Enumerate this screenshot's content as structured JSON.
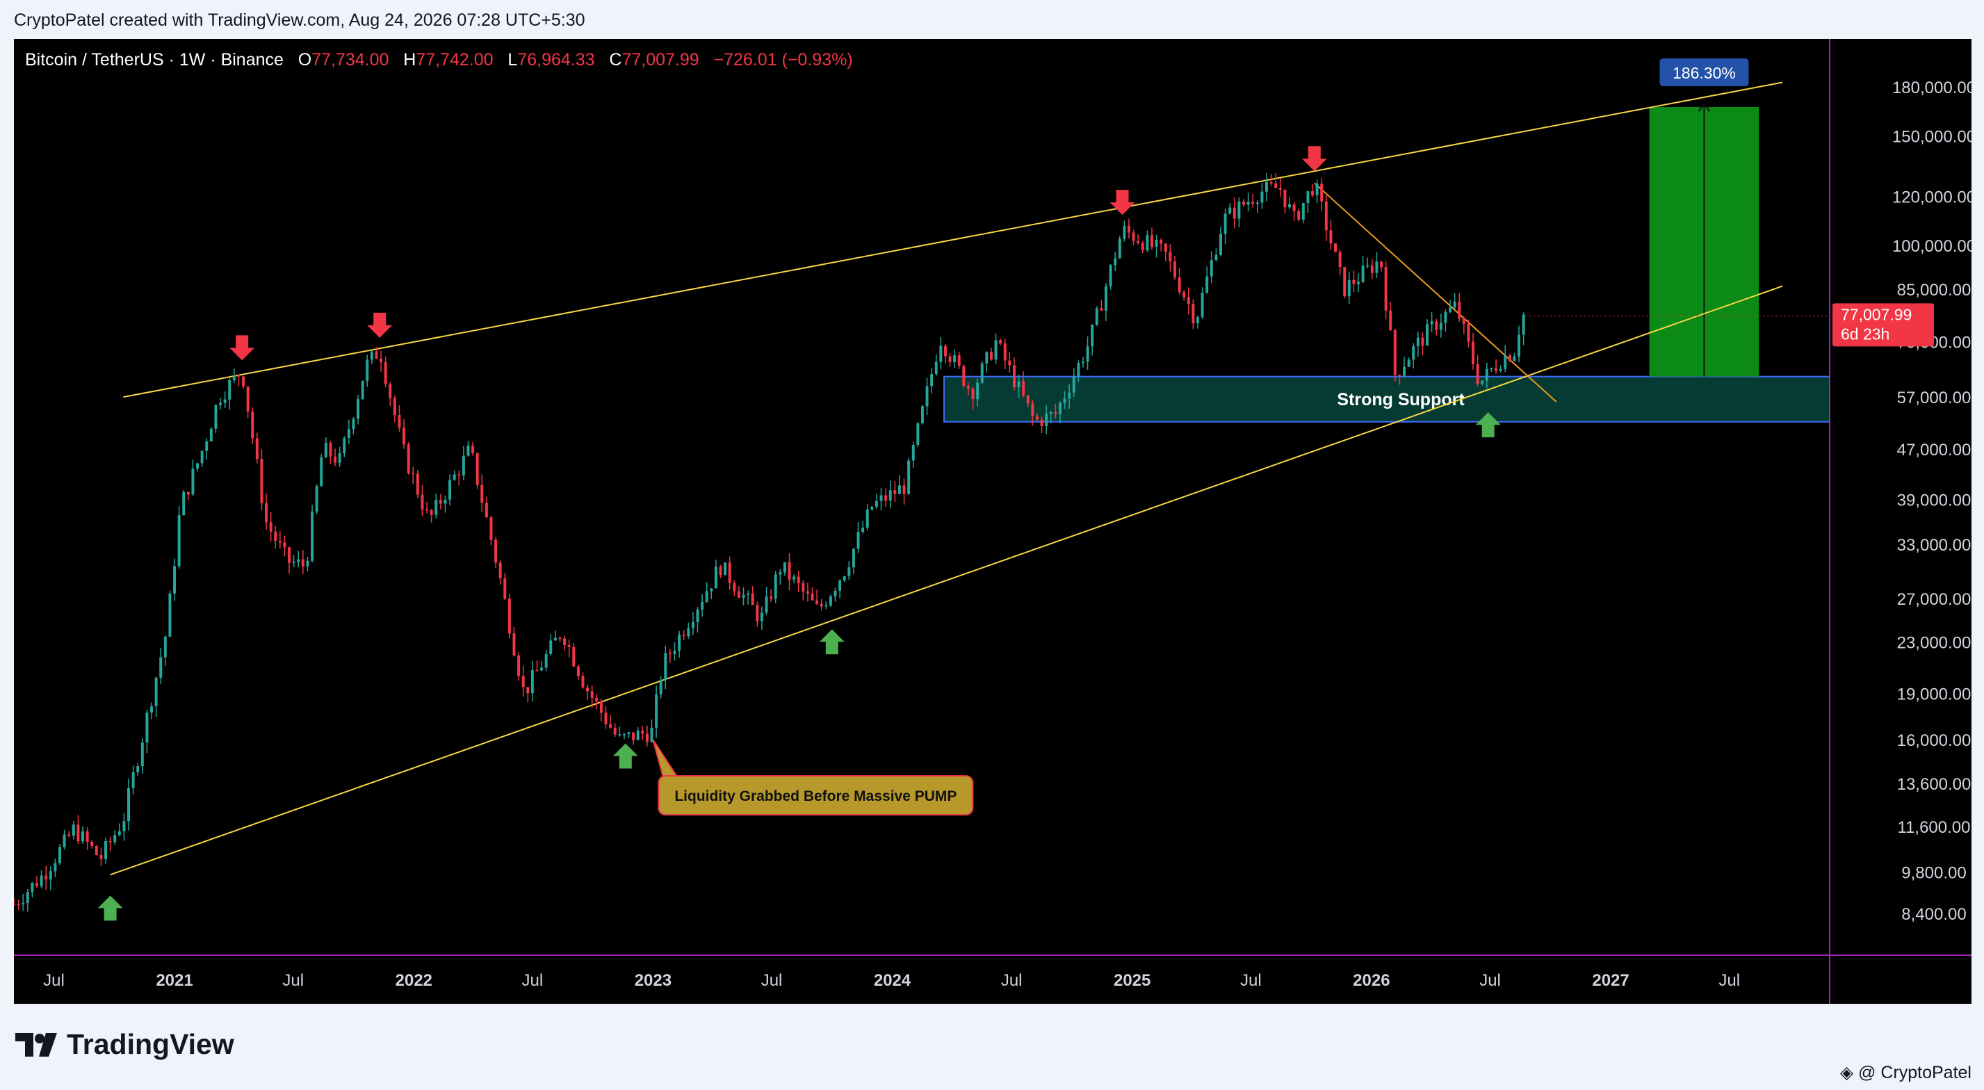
{
  "header": {
    "attribution": "CryptoPatel created with TradingView.com, Aug 24, 2026 07:28 UTC+5:30"
  },
  "legend": {
    "symbol": "Bitcoin / TetherUS · 1W · Binance",
    "open_label": "O",
    "open": "77,734.00",
    "high_label": "H",
    "high": "77,742.00",
    "low_label": "L",
    "low": "76,964.33",
    "close_label": "C",
    "close": "77,007.99",
    "change": "−726.01 (−0.93%)"
  },
  "colors": {
    "background": "#000000",
    "up": "#26a69a",
    "down": "#f23645",
    "trendline": "#f5d742",
    "support_fill": "#063b34",
    "support_border": "#3f6bff",
    "target_fill": "#0c8a16",
    "separator": "#9c27b0",
    "label_bubble": "#b7982a",
    "pct_badge": "#2452a8"
  },
  "chart_data": {
    "type": "candlestick",
    "x_axis": {
      "labels": [
        "Jul",
        "2021",
        "Jul",
        "2022",
        "Jul",
        "2023",
        "Jul",
        "2024",
        "Jul",
        "2025",
        "Jul",
        "2026",
        "Jul",
        "2027",
        "Jul"
      ],
      "range": [
        "2020-05",
        "2027-12"
      ]
    },
    "y_axis": {
      "scale": "log",
      "tick_labels": [
        "180,000.00",
        "150,000.00",
        "120,000.00",
        "100,000.00",
        "85,000.00",
        "70,000.00",
        "57,000.00",
        "47,000.00",
        "39,000.00",
        "33,000.00",
        "27,000.00",
        "23,000.00",
        "19,000.00",
        "16,000.00",
        "13,600.00",
        "11,600.00",
        "9,800.00",
        "8,400.00"
      ],
      "tick_values": [
        180000,
        150000,
        120000,
        100000,
        85000,
        70000,
        57000,
        47000,
        39000,
        33000,
        27000,
        23000,
        19000,
        16000,
        13600,
        11600,
        9800,
        8400
      ],
      "range": [
        7200,
        215000
      ]
    },
    "price_path": [
      [
        "2020-05-01",
        8700
      ],
      [
        "2020-06-15",
        9700
      ],
      [
        "2020-08-01",
        11500
      ],
      [
        "2020-09-10",
        10300
      ],
      [
        "2020-10-15",
        11900
      ],
      [
        "2020-11-15",
        16500
      ],
      [
        "2020-12-20",
        24000
      ],
      [
        "2021-01-10",
        38000
      ],
      [
        "2021-02-10",
        46000
      ],
      [
        "2021-03-10",
        57000
      ],
      [
        "2021-04-14",
        63000
      ],
      [
        "2021-05-20",
        36000
      ],
      [
        "2021-06-22",
        31000
      ],
      [
        "2021-07-20",
        30500
      ],
      [
        "2021-08-15",
        47000
      ],
      [
        "2021-09-10",
        45000
      ],
      [
        "2021-10-20",
        64000
      ],
      [
        "2021-11-10",
        68000
      ],
      [
        "2021-12-15",
        47000
      ],
      [
        "2022-01-24",
        36000
      ],
      [
        "2022-03-28",
        47000
      ],
      [
        "2022-05-10",
        30000
      ],
      [
        "2022-06-18",
        19000
      ],
      [
        "2022-08-15",
        24000
      ],
      [
        "2022-09-20",
        19500
      ],
      [
        "2022-11-09",
        16000
      ],
      [
        "2022-12-30",
        16500
      ],
      [
        "2023-01-15",
        21000
      ],
      [
        "2023-02-20",
        24500
      ],
      [
        "2023-04-14",
        30500
      ],
      [
        "2023-06-15",
        25000
      ],
      [
        "2023-07-15",
        30500
      ],
      [
        "2023-09-10",
        25800
      ],
      [
        "2023-10-20",
        30000
      ],
      [
        "2023-12-01",
        38000
      ],
      [
        "2024-01-20",
        41000
      ],
      [
        "2024-03-14",
        71000
      ],
      [
        "2024-05-01",
        58000
      ],
      [
        "2024-06-07",
        70000
      ],
      [
        "2024-08-05",
        52000
      ],
      [
        "2024-09-06",
        53500
      ],
      [
        "2024-10-28",
        70000
      ],
      [
        "2024-12-17",
        106000
      ],
      [
        "2025-02-20",
        97000
      ],
      [
        "2025-04-08",
        76000
      ],
      [
        "2025-05-20",
        110000
      ],
      [
        "2025-07-14",
        122000
      ],
      [
        "2025-08-14",
        124000
      ],
      [
        "2025-09-05",
        110000
      ],
      [
        "2025-10-06",
        126000
      ],
      [
        "2025-11-20",
        85000
      ],
      [
        "2026-01-15",
        95000
      ],
      [
        "2026-02-06",
        62000
      ],
      [
        "2026-03-15",
        70000
      ],
      [
        "2026-04-15",
        76000
      ],
      [
        "2026-05-10",
        80000
      ],
      [
        "2026-06-15",
        60000
      ],
      [
        "2026-07-20",
        66000
      ],
      [
        "2026-08-10",
        68000
      ],
      [
        "2026-08-17",
        77734
      ],
      [
        "2026-08-24",
        77008
      ]
    ],
    "last_price": {
      "value": 77007.99,
      "label": "77,007.99",
      "countdown": "6d 23h"
    },
    "trendlines": [
      {
        "from": [
          "2020-10-15",
          57000
        ],
        "to": [
          "2027-09-20",
          183000
        ]
      },
      {
        "from": [
          "2020-09-25",
          9700
        ],
        "to": [
          "2027-09-20",
          86000
        ]
      },
      {
        "from": [
          "2025-10-06",
          126000
        ],
        "to": [
          "2026-10-10",
          56000
        ]
      }
    ],
    "support_zone": {
      "label": "Strong Support",
      "from": "2024-03-20",
      "low": 52000,
      "high": 61500
    },
    "target_box": {
      "from": "2027-03-01",
      "to": "2027-08-15",
      "low": 61500,
      "high": 167000,
      "badge": "186.30%"
    },
    "annotation": {
      "text": "Liquidity Grabbed Before Massive PUMP",
      "anchor": [
        "2023-01-01",
        16000
      ]
    },
    "markers": {
      "down": [
        [
          "2021-04-14",
          63000
        ],
        [
          "2021-11-10",
          68500
        ],
        [
          "2024-12-17",
          108000
        ],
        [
          "2025-10-06",
          127000
        ]
      ],
      "up": [
        [
          "2020-09-25",
          9500
        ],
        [
          "2022-11-20",
          16700
        ],
        [
          "2023-10-01",
          25500
        ],
        [
          "2026-06-28",
          57000
        ]
      ]
    }
  },
  "footer": {
    "brand": "TradingView",
    "author": "@ CryptoPatel"
  }
}
